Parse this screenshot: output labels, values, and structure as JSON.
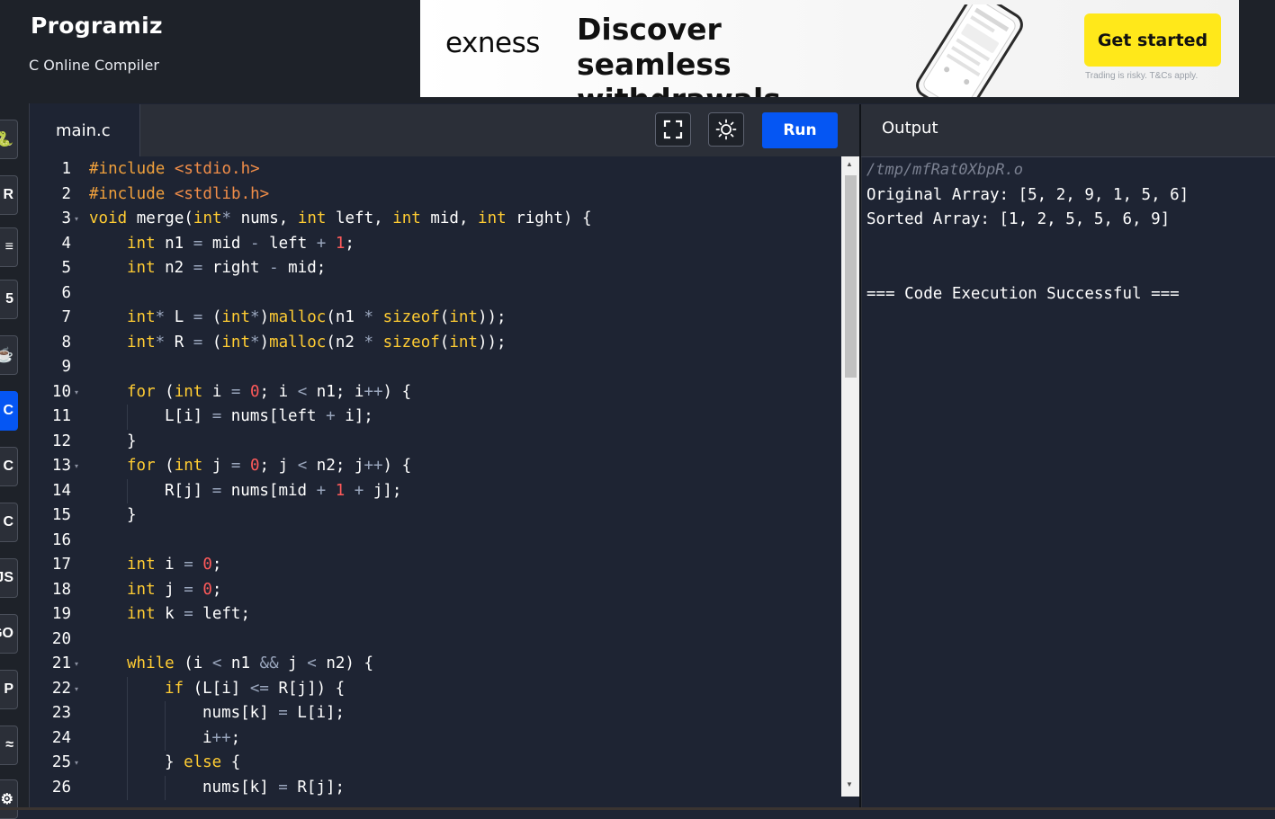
{
  "header": {
    "logo": "Programiz",
    "subtitle": "C Online Compiler"
  },
  "ad": {
    "brand": "exness",
    "headline": "Discover seamless withdrawals",
    "cta": "Get started",
    "fine_print": "Trading is risky. T&Cs apply.",
    "info_icon": "info-icon",
    "close_icon": "close-icon",
    "cta_color": "#ffe81a"
  },
  "sidebar": {
    "items": [
      {
        "icon": "python-icon",
        "glyph": "🐍"
      },
      {
        "icon": "r-icon",
        "glyph": "R"
      },
      {
        "icon": "sql-icon",
        "glyph": "≡"
      },
      {
        "icon": "html-icon",
        "glyph": "5"
      },
      {
        "icon": "java-icon",
        "glyph": "☕"
      },
      {
        "icon": "c-icon",
        "glyph": "C",
        "active": true
      },
      {
        "icon": "cpp-icon",
        "glyph": "C"
      },
      {
        "icon": "csharp-icon",
        "glyph": "C"
      },
      {
        "icon": "js-icon",
        "glyph": "JS"
      },
      {
        "icon": "go-icon",
        "glyph": "GO"
      },
      {
        "icon": "php-icon",
        "glyph": "P"
      },
      {
        "icon": "swift-icon",
        "glyph": "≈"
      },
      {
        "icon": "rust-icon",
        "glyph": "⚙"
      }
    ]
  },
  "editor": {
    "tab": "main.c",
    "fullscreen_icon": "fullscreen-icon",
    "theme_icon": "sun-icon",
    "run_label": "Run",
    "run_color": "#0556f3",
    "lines": [
      {
        "n": "1",
        "fold": false,
        "indent": 0,
        "tokens": [
          [
            "pp",
            "#include "
          ],
          [
            "str",
            "<stdio.h>"
          ]
        ]
      },
      {
        "n": "2",
        "fold": false,
        "indent": 0,
        "tokens": [
          [
            "pp",
            "#include "
          ],
          [
            "str",
            "<stdlib.h>"
          ]
        ]
      },
      {
        "n": "3",
        "fold": true,
        "indent": 0,
        "tokens": [
          [
            "kw",
            "void"
          ],
          [
            "id",
            " merge("
          ],
          [
            "kw",
            "int"
          ],
          [
            "op",
            "*"
          ],
          [
            "id",
            " nums, "
          ],
          [
            "kw",
            "int"
          ],
          [
            "id",
            " left, "
          ],
          [
            "kw",
            "int"
          ],
          [
            "id",
            " mid, "
          ],
          [
            "kw",
            "int"
          ],
          [
            "id",
            " right) {"
          ]
        ]
      },
      {
        "n": "4",
        "fold": false,
        "indent": 1,
        "tokens": [
          [
            "kw",
            "int"
          ],
          [
            "id",
            " n1 "
          ],
          [
            "op",
            "="
          ],
          [
            "id",
            " mid "
          ],
          [
            "op",
            "-"
          ],
          [
            "id",
            " left "
          ],
          [
            "op",
            "+"
          ],
          [
            "id",
            " "
          ],
          [
            "num",
            "1"
          ],
          [
            "id",
            ";"
          ]
        ]
      },
      {
        "n": "5",
        "fold": false,
        "indent": 1,
        "tokens": [
          [
            "kw",
            "int"
          ],
          [
            "id",
            " n2 "
          ],
          [
            "op",
            "="
          ],
          [
            "id",
            " right "
          ],
          [
            "op",
            "-"
          ],
          [
            "id",
            " mid;"
          ]
        ]
      },
      {
        "n": "6",
        "fold": false,
        "indent": 0,
        "tokens": []
      },
      {
        "n": "7",
        "fold": false,
        "indent": 1,
        "tokens": [
          [
            "kw",
            "int"
          ],
          [
            "op",
            "*"
          ],
          [
            "id",
            " L "
          ],
          [
            "op",
            "="
          ],
          [
            "id",
            " ("
          ],
          [
            "kw",
            "int"
          ],
          [
            "op",
            "*"
          ],
          [
            "id",
            ")"
          ],
          [
            "fn",
            "malloc"
          ],
          [
            "id",
            "(n1 "
          ],
          [
            "op",
            "*"
          ],
          [
            "id",
            " "
          ],
          [
            "fn",
            "sizeof"
          ],
          [
            "id",
            "("
          ],
          [
            "kw",
            "int"
          ],
          [
            "id",
            "));"
          ]
        ]
      },
      {
        "n": "8",
        "fold": false,
        "indent": 1,
        "tokens": [
          [
            "kw",
            "int"
          ],
          [
            "op",
            "*"
          ],
          [
            "id",
            " R "
          ],
          [
            "op",
            "="
          ],
          [
            "id",
            " ("
          ],
          [
            "kw",
            "int"
          ],
          [
            "op",
            "*"
          ],
          [
            "id",
            ")"
          ],
          [
            "fn",
            "malloc"
          ],
          [
            "id",
            "(n2 "
          ],
          [
            "op",
            "*"
          ],
          [
            "id",
            " "
          ],
          [
            "fn",
            "sizeof"
          ],
          [
            "id",
            "("
          ],
          [
            "kw",
            "int"
          ],
          [
            "id",
            "));"
          ]
        ]
      },
      {
        "n": "9",
        "fold": false,
        "indent": 0,
        "tokens": []
      },
      {
        "n": "10",
        "fold": true,
        "indent": 1,
        "tokens": [
          [
            "kw",
            "for"
          ],
          [
            "id",
            " ("
          ],
          [
            "kw",
            "int"
          ],
          [
            "id",
            " i "
          ],
          [
            "op",
            "="
          ],
          [
            "id",
            " "
          ],
          [
            "num",
            "0"
          ],
          [
            "id",
            "; i "
          ],
          [
            "op",
            "<"
          ],
          [
            "id",
            " n1; i"
          ],
          [
            "op",
            "++"
          ],
          [
            "id",
            ") {"
          ]
        ]
      },
      {
        "n": "11",
        "fold": false,
        "indent": 2,
        "tokens": [
          [
            "id",
            "L[i] "
          ],
          [
            "op",
            "="
          ],
          [
            "id",
            " nums[left "
          ],
          [
            "op",
            "+"
          ],
          [
            "id",
            " i];"
          ]
        ]
      },
      {
        "n": "12",
        "fold": false,
        "indent": 1,
        "tokens": [
          [
            "id",
            "}"
          ]
        ]
      },
      {
        "n": "13",
        "fold": true,
        "indent": 1,
        "tokens": [
          [
            "kw",
            "for"
          ],
          [
            "id",
            " ("
          ],
          [
            "kw",
            "int"
          ],
          [
            "id",
            " j "
          ],
          [
            "op",
            "="
          ],
          [
            "id",
            " "
          ],
          [
            "num",
            "0"
          ],
          [
            "id",
            "; j "
          ],
          [
            "op",
            "<"
          ],
          [
            "id",
            " n2; j"
          ],
          [
            "op",
            "++"
          ],
          [
            "id",
            ") {"
          ]
        ]
      },
      {
        "n": "14",
        "fold": false,
        "indent": 2,
        "tokens": [
          [
            "id",
            "R[j] "
          ],
          [
            "op",
            "="
          ],
          [
            "id",
            " nums[mid "
          ],
          [
            "op",
            "+"
          ],
          [
            "id",
            " "
          ],
          [
            "num",
            "1"
          ],
          [
            "id",
            " "
          ],
          [
            "op",
            "+"
          ],
          [
            "id",
            " j];"
          ]
        ]
      },
      {
        "n": "15",
        "fold": false,
        "indent": 1,
        "tokens": [
          [
            "id",
            "}"
          ]
        ]
      },
      {
        "n": "16",
        "fold": false,
        "indent": 0,
        "tokens": []
      },
      {
        "n": "17",
        "fold": false,
        "indent": 1,
        "tokens": [
          [
            "kw",
            "int"
          ],
          [
            "id",
            " i "
          ],
          [
            "op",
            "="
          ],
          [
            "id",
            " "
          ],
          [
            "num",
            "0"
          ],
          [
            "id",
            ";"
          ]
        ]
      },
      {
        "n": "18",
        "fold": false,
        "indent": 1,
        "tokens": [
          [
            "kw",
            "int"
          ],
          [
            "id",
            " j "
          ],
          [
            "op",
            "="
          ],
          [
            "id",
            " "
          ],
          [
            "num",
            "0"
          ],
          [
            "id",
            ";"
          ]
        ]
      },
      {
        "n": "19",
        "fold": false,
        "indent": 1,
        "tokens": [
          [
            "kw",
            "int"
          ],
          [
            "id",
            " k "
          ],
          [
            "op",
            "="
          ],
          [
            "id",
            " left;"
          ]
        ]
      },
      {
        "n": "20",
        "fold": false,
        "indent": 0,
        "tokens": []
      },
      {
        "n": "21",
        "fold": true,
        "indent": 1,
        "tokens": [
          [
            "kw",
            "while"
          ],
          [
            "id",
            " (i "
          ],
          [
            "op",
            "<"
          ],
          [
            "id",
            " n1 "
          ],
          [
            "op",
            "&&"
          ],
          [
            "id",
            " j "
          ],
          [
            "op",
            "<"
          ],
          [
            "id",
            " n2) {"
          ]
        ]
      },
      {
        "n": "22",
        "fold": true,
        "indent": 2,
        "tokens": [
          [
            "kw",
            "if"
          ],
          [
            "id",
            " (L[i] "
          ],
          [
            "op",
            "<="
          ],
          [
            "id",
            " R[j]) {"
          ]
        ]
      },
      {
        "n": "23",
        "fold": false,
        "indent": 3,
        "tokens": [
          [
            "id",
            "nums[k] "
          ],
          [
            "op",
            "="
          ],
          [
            "id",
            " L[i];"
          ]
        ]
      },
      {
        "n": "24",
        "fold": false,
        "indent": 3,
        "tokens": [
          [
            "id",
            "i"
          ],
          [
            "op",
            "++"
          ],
          [
            "id",
            ";"
          ]
        ]
      },
      {
        "n": "25",
        "fold": true,
        "indent": 2,
        "tokens": [
          [
            "id",
            "} "
          ],
          [
            "kw",
            "else"
          ],
          [
            "id",
            " {"
          ]
        ]
      },
      {
        "n": "26",
        "fold": false,
        "indent": 3,
        "tokens": [
          [
            "id",
            "nums[k] "
          ],
          [
            "op",
            "="
          ],
          [
            "id",
            " R[j];"
          ]
        ]
      }
    ]
  },
  "output": {
    "title": "Output",
    "lines": [
      {
        "text": "/tmp/mfRat0XbpR.o",
        "kind": "path"
      },
      {
        "text": "Original Array: [5, 2, 9, 1, 5, 6]",
        "kind": "text"
      },
      {
        "text": "Sorted Array: [1, 2, 5, 5, 6, 9]",
        "kind": "text"
      },
      {
        "text": "",
        "kind": "text"
      },
      {
        "text": "",
        "kind": "text"
      },
      {
        "text": "=== Code Execution Successful ===",
        "kind": "text"
      }
    ]
  }
}
